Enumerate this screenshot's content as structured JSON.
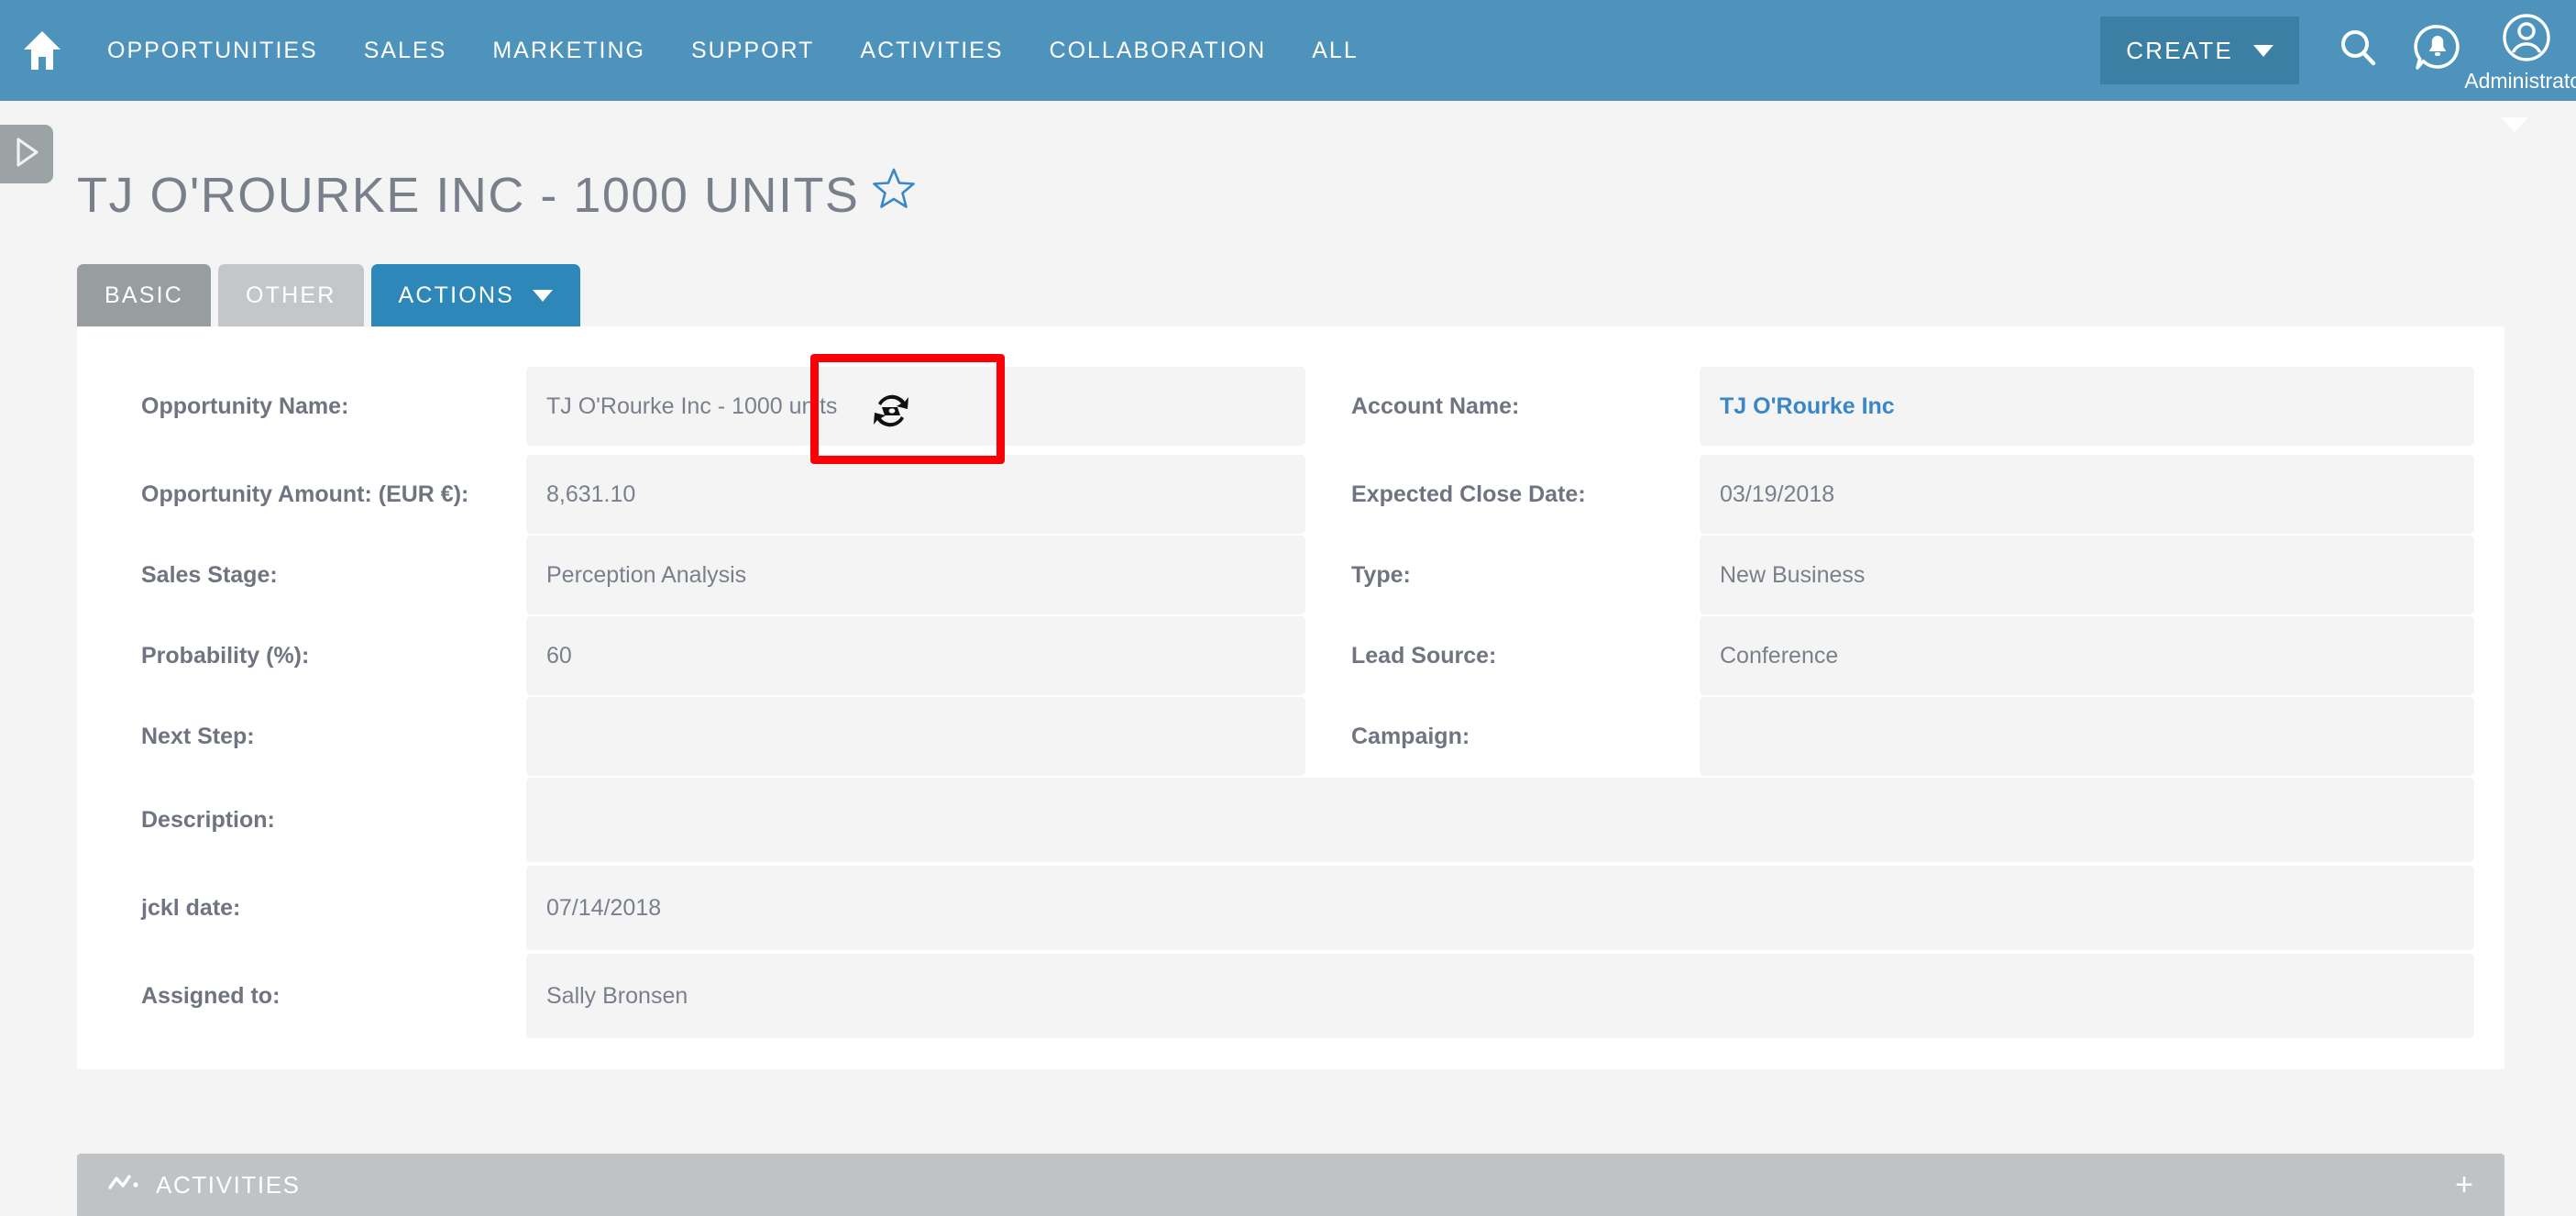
{
  "topnav": {
    "home_icon": "home-icon",
    "links": [
      {
        "label": "OPPORTUNITIES"
      },
      {
        "label": "SALES"
      },
      {
        "label": "MARKETING"
      },
      {
        "label": "SUPPORT"
      },
      {
        "label": "ACTIVITIES"
      },
      {
        "label": "COLLABORATION"
      },
      {
        "label": "ALL"
      }
    ],
    "create_label": "CREATE",
    "search_icon": "search-icon",
    "notifications_icon": "notification-bell-icon",
    "user_icon": "user-avatar-icon",
    "user_name": "Administrator",
    "bg_color": "#4e93bb",
    "create_bg_color": "#3b7fa4"
  },
  "sidebar_toggle": {
    "icon": "play-arrow-right-icon"
  },
  "page_chevron": {
    "icon": "chevron-down-icon"
  },
  "record": {
    "title": "TJ O'Rourke Inc - 1000 units",
    "favorite_icon": "star-outline-icon"
  },
  "tabs": [
    {
      "label": "BASIC",
      "state": "active"
    },
    {
      "label": "OTHER",
      "state": "inactive"
    },
    {
      "label": "ACTIONS",
      "state": "dropdown"
    }
  ],
  "fields": {
    "opportunity_name_label": "Opportunity Name:",
    "opportunity_name_value": "TJ O'Rourke Inc - 1000 units",
    "account_name_label": "Account Name:",
    "account_name_value": "TJ O'Rourke Inc",
    "opportunity_amount_label": "Opportunity Amount: (EUR €):",
    "opportunity_amount_value": "8,631.10",
    "expected_close_date_label": "Expected Close Date:",
    "expected_close_date_value": "03/19/2018",
    "sales_stage_label": "Sales Stage:",
    "sales_stage_value": "Perception Analysis",
    "type_label": "Type:",
    "type_value": "New Business",
    "probability_label": "Probability (%):",
    "probability_value": "60",
    "lead_source_label": "Lead Source:",
    "lead_source_value": "Conference",
    "next_step_label": "Next Step:",
    "next_step_value": "",
    "campaign_label": "Campaign:",
    "campaign_value": "",
    "description_label": "Description:",
    "description_value": "",
    "jckl_date_label": "jckl date:",
    "jckl_date_value": "07/14/2018",
    "assigned_to_label": "Assigned to:",
    "assigned_to_value": "Sally Bronsen"
  },
  "activities_panel": {
    "icon": "line-chart-icon",
    "title": "ACTIVITIES",
    "add_label": "+"
  },
  "annotation": {
    "highlight_color": "#fb0007",
    "cursor_icon": "sync-busy-cursor-icon"
  },
  "colors": {
    "nav_blue": "#4e93bb",
    "actions_blue": "#2d87b8",
    "link_blue": "#3a87c8",
    "tab_active_gray": "#989e9f",
    "tab_inactive_gray": "#c4c7c9",
    "panel_gray": "#c0c3c5",
    "field_bg": "#f4f4f4",
    "label_text": "#6f7480"
  }
}
